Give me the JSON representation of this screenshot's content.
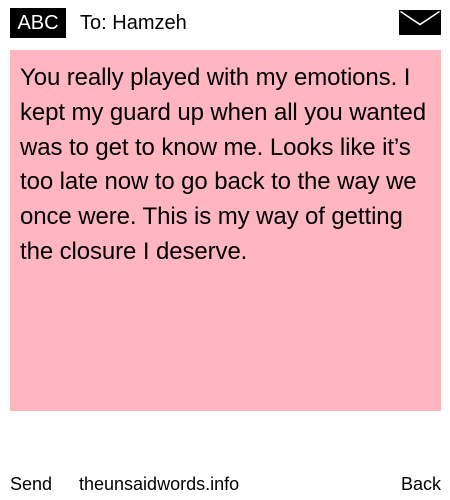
{
  "header": {
    "mode_label": "ABC",
    "to_prefix": "To:",
    "recipient": "Hamzeh",
    "mail_icon": "envelope-icon"
  },
  "message": {
    "text": "You really played with my emotions. I kept my guard up when all you wanted was to get to know me. Looks like it’s too late now to go back to the way we once were. This is my way of getting the closure I deserve.",
    "background": "#ffb6c1"
  },
  "footer": {
    "send_label": "Send",
    "site_label": "theunsaidwords.info",
    "back_label": "Back"
  },
  "colors": {
    "accent": "#000000",
    "page_background": "#ffffff"
  }
}
